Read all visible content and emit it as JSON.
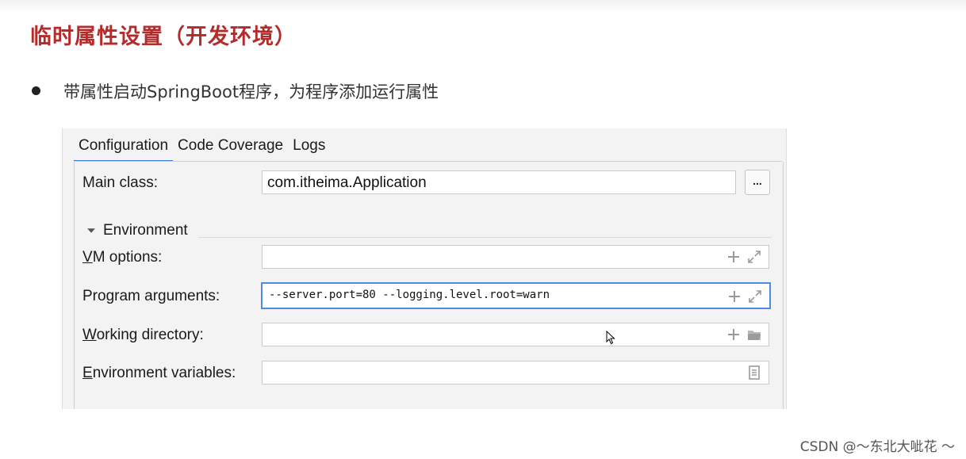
{
  "slide": {
    "title": "临时属性设置（开发环境）",
    "bullet": "带属性启动SpringBoot程序，为程序添加运行属性"
  },
  "tabs": [
    {
      "label": "Configuration",
      "active": true
    },
    {
      "label": "Code Coverage",
      "active": false
    },
    {
      "label": "Logs",
      "active": false
    }
  ],
  "form": {
    "main_class": {
      "label": "Main class:",
      "value": "com.itheima.Application",
      "browse_label": "..."
    },
    "environment_section": {
      "label_pre": "Environment",
      "collapsed": false
    },
    "vm_options": {
      "label_mnemonic": "V",
      "label_rest": "M options:",
      "value": ""
    },
    "program_arguments": {
      "label_pre": "Program ar",
      "label_mnemonic": "g",
      "label_post": "uments:",
      "value": "--server.port=80 --logging.level.root=warn"
    },
    "working_directory": {
      "label_mnemonic": "W",
      "label_rest": "orking directory:",
      "value": ""
    },
    "environment_variables": {
      "label_mnemonic": "E",
      "label_rest": "nvironment variables:",
      "value": ""
    }
  },
  "colors": {
    "accent": "#3d7fd8",
    "title": "#b22c2c"
  },
  "watermark": "CSDN @～东北大呲花 ～"
}
